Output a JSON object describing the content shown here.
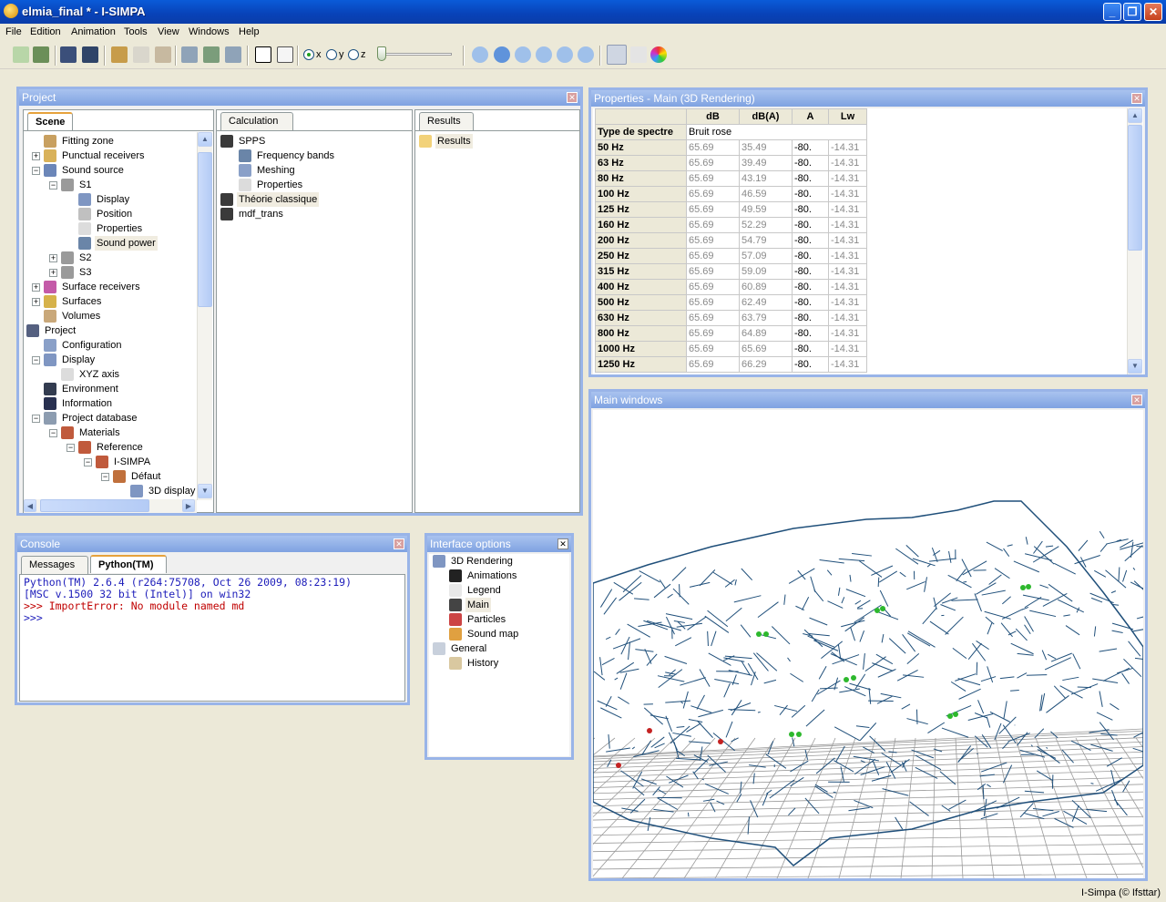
{
  "window": {
    "title": "elmia_final * - I-SIMPA",
    "minimize": "_",
    "restore": "❐",
    "close": "✕"
  },
  "menu": [
    "File",
    "Edition",
    "Animation",
    "Tools",
    "View",
    "Windows",
    "Help"
  ],
  "toolbar": {
    "axis_x": "x",
    "axis_y": "y",
    "axis_z": "z"
  },
  "project_panel": {
    "title": "Project",
    "scene_tab": "Scene",
    "calculation_tab": "Calculation",
    "results_tab": "Results",
    "scene_tree": [
      "Fitting zone",
      "Punctual receivers",
      "Sound source",
      "S1",
      "Display",
      "Position",
      "Properties",
      "Sound power",
      "S2",
      "S3",
      "Surface receivers",
      "Surfaces",
      "Volumes",
      "Project",
      "Configuration",
      "Display",
      "XYZ axis",
      "Environment",
      "Information",
      "Project database",
      "Materials",
      "Reference",
      "I-SIMPA",
      "Défaut",
      "3D display"
    ],
    "calc_tree": [
      "SPPS",
      "Frequency bands",
      "Meshing",
      "Properties",
      "Théorie classique",
      "mdf_trans"
    ],
    "results_tree": [
      "Results"
    ]
  },
  "properties_panel": {
    "title": "Properties - Main (3D Rendering)",
    "columns": [
      "dB",
      "dB(A)",
      "A",
      "Lw"
    ],
    "spectrum_label": "Type de spectre",
    "spectrum_value": "Bruit rose",
    "rows": [
      {
        "band": "50 Hz",
        "db": "65.69",
        "dba": "35.49",
        "a": "-80.",
        "lw": "-14.31"
      },
      {
        "band": "63 Hz",
        "db": "65.69",
        "dba": "39.49",
        "a": "-80.",
        "lw": "-14.31"
      },
      {
        "band": "80 Hz",
        "db": "65.69",
        "dba": "43.19",
        "a": "-80.",
        "lw": "-14.31"
      },
      {
        "band": "100 Hz",
        "db": "65.69",
        "dba": "46.59",
        "a": "-80.",
        "lw": "-14.31"
      },
      {
        "band": "125 Hz",
        "db": "65.69",
        "dba": "49.59",
        "a": "-80.",
        "lw": "-14.31"
      },
      {
        "band": "160 Hz",
        "db": "65.69",
        "dba": "52.29",
        "a": "-80.",
        "lw": "-14.31"
      },
      {
        "band": "200 Hz",
        "db": "65.69",
        "dba": "54.79",
        "a": "-80.",
        "lw": "-14.31"
      },
      {
        "band": "250 Hz",
        "db": "65.69",
        "dba": "57.09",
        "a": "-80.",
        "lw": "-14.31"
      },
      {
        "band": "315 Hz",
        "db": "65.69",
        "dba": "59.09",
        "a": "-80.",
        "lw": "-14.31"
      },
      {
        "band": "400 Hz",
        "db": "65.69",
        "dba": "60.89",
        "a": "-80.",
        "lw": "-14.31"
      },
      {
        "band": "500 Hz",
        "db": "65.69",
        "dba": "62.49",
        "a": "-80.",
        "lw": "-14.31"
      },
      {
        "band": "630 Hz",
        "db": "65.69",
        "dba": "63.79",
        "a": "-80.",
        "lw": "-14.31"
      },
      {
        "band": "800 Hz",
        "db": "65.69",
        "dba": "64.89",
        "a": "-80.",
        "lw": "-14.31"
      },
      {
        "band": "1000 Hz",
        "db": "65.69",
        "dba": "65.69",
        "a": "-80.",
        "lw": "-14.31"
      },
      {
        "band": "1250 Hz",
        "db": "65.69",
        "dba": "66.29",
        "a": "-80.",
        "lw": "-14.31"
      }
    ]
  },
  "main_window": {
    "title": "Main windows"
  },
  "console_panel": {
    "title": "Console",
    "tabs": [
      "Messages",
      "Python(TM)"
    ],
    "lines": [
      "Python(TM) 2.6.4 (r264:75708, Oct 26 2009, 08:23:19)",
      "[MSC v.1500 32 bit (Intel)] on win32"
    ],
    "error_line": ">>> ImportError: No module named md",
    "prompt": ">>>"
  },
  "interface_panel": {
    "title": "Interface options",
    "items": [
      "3D Rendering",
      "Animations",
      "Legend",
      "Main",
      "Particles",
      "Sound map",
      "General",
      "History"
    ]
  },
  "status": {
    "credit": "I-Simpa (© Ifsttar)"
  }
}
